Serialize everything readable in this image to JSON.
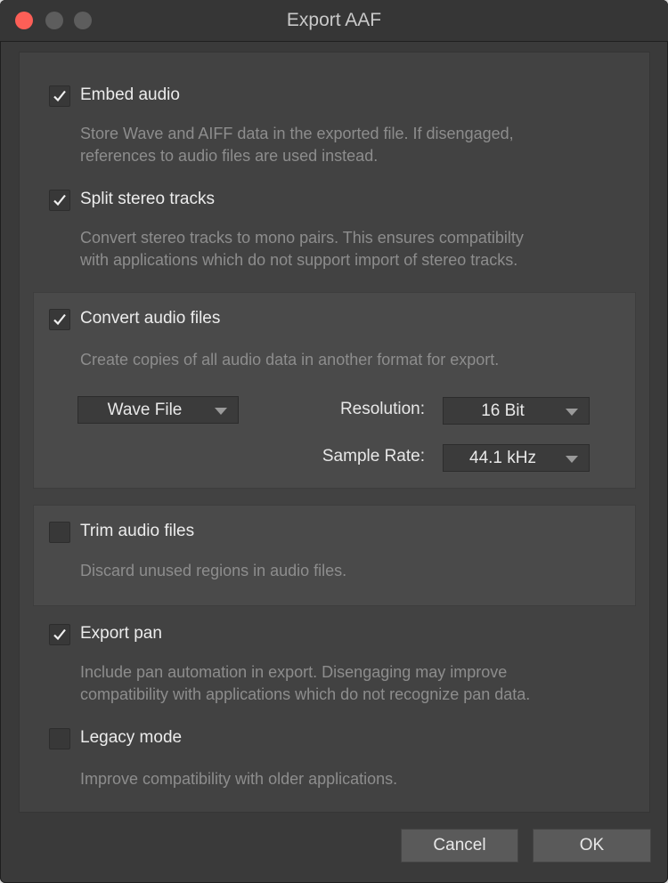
{
  "window": {
    "title": "Export AAF"
  },
  "options": {
    "embed_audio": {
      "label": "Embed audio",
      "checked": true,
      "desc": [
        "Store Wave and AIFF data in the exported file. If disengaged,",
        "references to audio files are used instead."
      ]
    },
    "split_stereo": {
      "label": "Split stereo tracks",
      "checked": true,
      "desc": [
        "Convert stereo tracks to mono pairs. This ensures compatibilty",
        "with applications which do not support import of stereo tracks."
      ]
    },
    "convert_audio": {
      "label": "Convert audio files",
      "checked": true,
      "desc": [
        "Create copies of all audio data in another format for export."
      ],
      "format": {
        "value": "Wave File"
      },
      "resolution": {
        "label": "Resolution:",
        "value": "16 Bit"
      },
      "sample_rate": {
        "label": "Sample Rate:",
        "value": "44.1 kHz"
      }
    },
    "trim_audio": {
      "label": "Trim audio files",
      "checked": false,
      "desc": [
        "Discard unused regions in audio files."
      ]
    },
    "export_pan": {
      "label": "Export pan",
      "checked": true,
      "desc": [
        "Include pan automation in export. Disengaging may improve",
        "compatibility with applications which do not recognize pan data."
      ]
    },
    "legacy_mode": {
      "label": "Legacy mode",
      "checked": false,
      "desc": [
        "Improve compatibility with older applications."
      ]
    }
  },
  "buttons": {
    "cancel": "Cancel",
    "ok": "OK"
  },
  "colors": {
    "close": "#fc5f57",
    "background": "#3a3a3a",
    "panel": "#424242",
    "group": "#4a4a4a"
  },
  "icons": {
    "check": "checkmark-icon",
    "dropdown": "dropdown-arrow-icon"
  }
}
